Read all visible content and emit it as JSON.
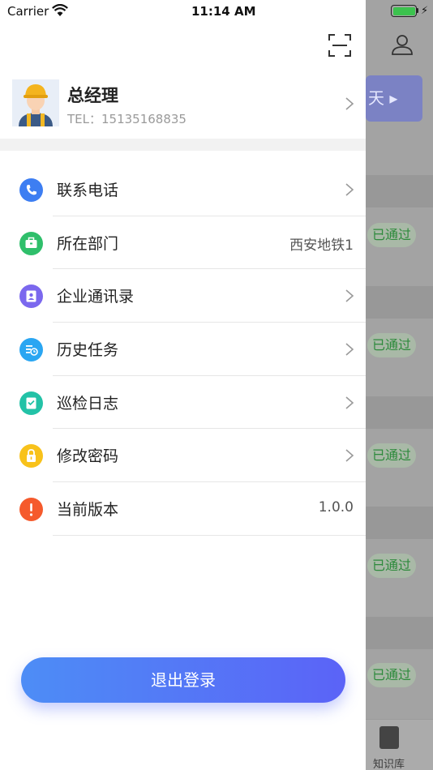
{
  "status_bar": {
    "carrier": "Carrier",
    "time": "11:14 AM"
  },
  "background": {
    "button_text": "天",
    "badges": [
      "已通过",
      "已通过",
      "已通过",
      "已通过",
      "已通过"
    ],
    "tab_label": "知识库"
  },
  "profile": {
    "name": "总经理",
    "tel": "TEL：15135168835"
  },
  "menu": [
    {
      "label": "联系电话",
      "value": "",
      "icon": "phone-icon",
      "color": "#3d7ef2"
    },
    {
      "label": "所在部门",
      "value": "西安地铁1",
      "icon": "briefcase-icon",
      "color": "#2fbf6b"
    },
    {
      "label": "企业通讯录",
      "value": "",
      "icon": "contacts-icon",
      "color": "#7b68ee"
    },
    {
      "label": "历史任务",
      "value": "",
      "icon": "history-icon",
      "color": "#2aa6f2"
    },
    {
      "label": "巡检日志",
      "value": "",
      "icon": "log-icon",
      "color": "#23c2a7"
    },
    {
      "label": "修改密码",
      "value": "",
      "icon": "lock-icon",
      "color": "#f8c21b"
    },
    {
      "label": "当前版本",
      "value": "1.0.0",
      "icon": "alert-icon",
      "color": "#f55a2c"
    }
  ],
  "logout_label": "退出登录"
}
